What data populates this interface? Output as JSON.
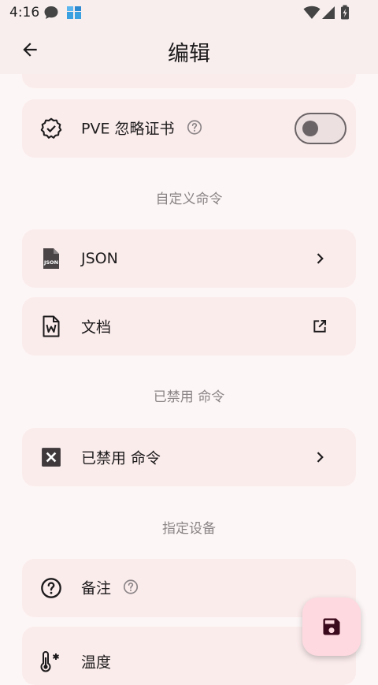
{
  "status_bar": {
    "time": "4:16"
  },
  "app_bar": {
    "title": "编辑"
  },
  "rows": {
    "pve_ignore_cert": {
      "label": "PVE 忽略证书",
      "toggle_on": false
    },
    "json": {
      "label": "JSON"
    },
    "docs": {
      "label": "文档"
    },
    "disabled_commands": {
      "label": "已禁用 命令"
    },
    "remark": {
      "label": "备注"
    },
    "temperature": {
      "label": "温度"
    }
  },
  "sections": {
    "custom_commands": "自定义命令",
    "disabled_commands": "已禁用 命令",
    "specified_device": "指定设备"
  },
  "colors": {
    "accent": "#ffd9e0",
    "card": "#fbecec",
    "background": "#fdf6f6"
  }
}
